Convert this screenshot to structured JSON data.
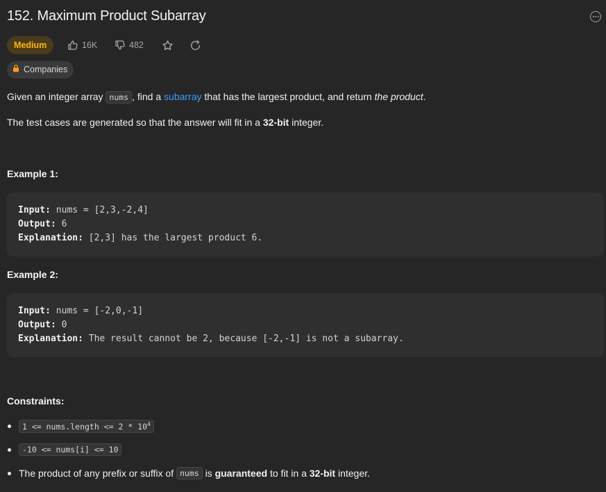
{
  "problem": {
    "title": "152. Maximum Product Subarray",
    "difficulty": "Medium",
    "likes": "16K",
    "dislikes": "482",
    "companies_label": "Companies"
  },
  "description": {
    "p1_prefix": "Given an integer array ",
    "p1_code": "nums",
    "p1_mid": ", find a ",
    "p1_link": "subarray",
    "p1_after": " that has the largest product, and return ",
    "p1_em": "the product",
    "p1_end": ".",
    "p2_prefix": "The test cases are generated so that the answer will fit in a ",
    "p2_bold": "32-bit",
    "p2_end": " integer."
  },
  "examples": [
    {
      "heading": "Example 1:",
      "input_label": "Input:",
      "input": " nums = [2,3,-2,4]",
      "output_label": "Output:",
      "output": " 6",
      "explanation_label": "Explanation:",
      "explanation": " [2,3] has the largest product 6."
    },
    {
      "heading": "Example 2:",
      "input_label": "Input:",
      "input": " nums = [-2,0,-1]",
      "output_label": "Output:",
      "output": " 0",
      "explanation_label": "Explanation:",
      "explanation": " The result cannot be 2, because [-2,-1] is not a subarray."
    }
  ],
  "constraints": {
    "heading": "Constraints:",
    "c1_code": "1 <= nums.length <= 2 * 10",
    "c1_sup": "4",
    "c2_code": "-10 <= nums[i] <= 10",
    "c3_prefix": "The product of any prefix or suffix of ",
    "c3_code": "nums",
    "c3_mid": " is ",
    "c3_bold1": "guaranteed",
    "c3_mid2": " to fit in a ",
    "c3_bold2": "32-bit",
    "c3_end": " integer."
  },
  "colors": {
    "background": "#262626",
    "medium": "#ffb800",
    "link": "#3b9cff"
  },
  "icons": [
    "thumbs-up-icon",
    "thumbs-down-icon",
    "star-icon",
    "share-icon",
    "lock-icon",
    "more-icon"
  ]
}
